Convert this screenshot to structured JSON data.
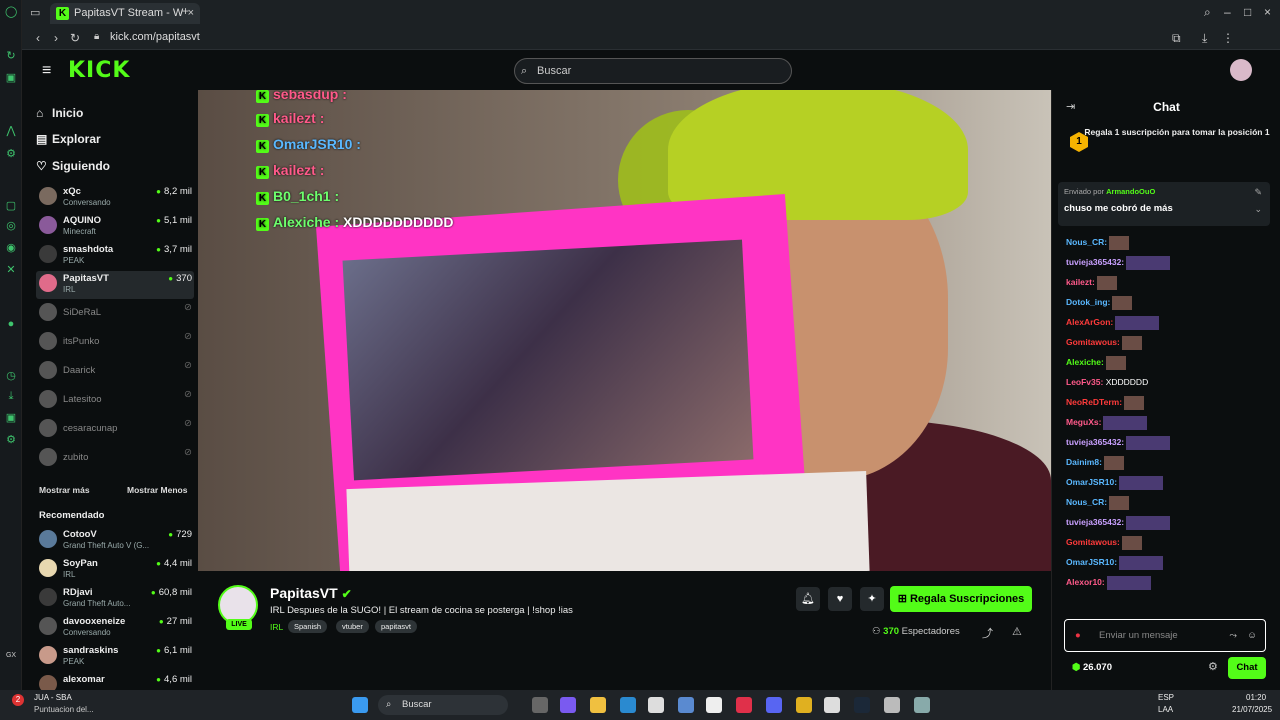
{
  "browser": {
    "tab_title": "PapitasVT Stream - W",
    "url": "kick.com/papitasvt"
  },
  "header": {
    "logo": "KICK",
    "search_placeholder": "Buscar"
  },
  "nav": {
    "home": "Inicio",
    "explore": "Explorar",
    "following": "Siguiendo"
  },
  "following": [
    {
      "name": "xQc",
      "category": "Conversando",
      "viewers": "8,2 mil",
      "live": true
    },
    {
      "name": "AQUINO",
      "category": "Minecraft",
      "viewers": "5,1 mil",
      "live": true
    },
    {
      "name": "smashdota",
      "category": "PEAK",
      "viewers": "3,7 mil",
      "live": true
    },
    {
      "name": "PapitasVT",
      "category": "IRL",
      "viewers": "370",
      "live": true
    },
    {
      "name": "SiDeRaL",
      "category": "",
      "viewers": "",
      "live": false
    },
    {
      "name": "itsPunko",
      "category": "",
      "viewers": "",
      "live": false
    },
    {
      "name": "Daarick",
      "category": "",
      "viewers": "",
      "live": false
    },
    {
      "name": "Latesitoo",
      "category": "",
      "viewers": "",
      "live": false
    },
    {
      "name": "cesaracunap",
      "category": "",
      "viewers": "",
      "live": false
    },
    {
      "name": "zubito",
      "category": "",
      "viewers": "",
      "live": false
    }
  ],
  "show_more": "Mostrar más",
  "show_less": "Mostrar Menos",
  "recommended_label": "Recomendado",
  "recommended": [
    {
      "name": "CotooV",
      "category": "Grand Theft Auto V (G...",
      "viewers": "729"
    },
    {
      "name": "SoyPan",
      "category": "IRL",
      "viewers": "4,4 mil"
    },
    {
      "name": "RDjavi",
      "category": "Grand Theft Auto...",
      "viewers": "60,8 mil"
    },
    {
      "name": "davooxeneize",
      "category": "Conversando",
      "viewers": "27 mil"
    },
    {
      "name": "sandraskins",
      "category": "PEAK",
      "viewers": "6,1 mil"
    },
    {
      "name": "alexomar",
      "category": "",
      "viewers": "4,6 mil"
    }
  ],
  "overlay_chat": [
    {
      "user": "sebasdup :",
      "msg": "",
      "color": "red"
    },
    {
      "user": "kailezt :",
      "msg": "",
      "color": "red"
    },
    {
      "user": "OmarJSR10 :",
      "msg": "",
      "color": "blue"
    },
    {
      "user": "kailezt :",
      "msg": "",
      "color": "red"
    },
    {
      "user": "B0_1ch1 :",
      "msg": "",
      "color": "green"
    },
    {
      "user": "Alexiche :",
      "msg": "XDDDDDDDDDD",
      "color": "green"
    }
  ],
  "stream": {
    "streamer": "PapitasVT",
    "title": "IRL Despues de la SUGO!  | El stream de cocina se posterga | !shop !ias",
    "category": "IRL",
    "tags": [
      "Spanish",
      "vtuber",
      "papitasvt"
    ],
    "live_badge": "LIVE",
    "subscribe_label": "Regala Suscripciones",
    "viewers_count": "370",
    "viewers_label": "Espectadores"
  },
  "chat": {
    "title": "Chat",
    "gift_rank": "1",
    "gift_prompt": "Regala 1 suscripción para tomar la posición 1",
    "pinned_by_label": "Enviado por",
    "pinned_by_user": "ArmandoOuO",
    "pinned_text": "chuso me cobró de más",
    "messages": [
      {
        "user": "Nous_CR:",
        "color": "#5ab8ff",
        "text": "",
        "emote": "brown"
      },
      {
        "user": "tuvieja365432:",
        "color": "#c9a0ff",
        "text": "",
        "emote": "purple"
      },
      {
        "user": "kailezt:",
        "color": "#ff5a8a",
        "text": "",
        "emote": "brown"
      },
      {
        "user": "Dotok_ing:",
        "color": "#5ab8ff",
        "text": "",
        "emote": "brown"
      },
      {
        "user": "AlexArGon:",
        "color": "#ff3b3b",
        "text": "",
        "emote": "purple"
      },
      {
        "user": "Gomitawous:",
        "color": "#ff3b3b",
        "text": "",
        "emote": "brown"
      },
      {
        "user": "Alexiche:",
        "color": "#53fc18",
        "text": "",
        "emote": "brown"
      },
      {
        "user": "LeoFv35:",
        "color": "#ff5a8a",
        "text": "XDDDDDD",
        "emote": ""
      },
      {
        "user": "NeoReDTerm:",
        "color": "#ff3b3b",
        "text": "",
        "emote": "brown"
      },
      {
        "user": "MeguXs:",
        "color": "#ff5a8a",
        "text": "",
        "emote": "purple"
      },
      {
        "user": "tuvieja365432:",
        "color": "#c9a0ff",
        "text": "",
        "emote": "purple"
      },
      {
        "user": "Dainim8:",
        "color": "#5ab8ff",
        "text": "",
        "emote": "brown"
      },
      {
        "user": "OmarJSR10:",
        "color": "#5ab8ff",
        "text": "",
        "emote": "purple"
      },
      {
        "user": "Nous_CR:",
        "color": "#5ab8ff",
        "text": "",
        "emote": "brown"
      },
      {
        "user": "tuvieja365432:",
        "color": "#c9a0ff",
        "text": "",
        "emote": "purple"
      },
      {
        "user": "Gomitawous:",
        "color": "#ff3b3b",
        "text": "",
        "emote": "brown"
      },
      {
        "user": "OmarJSR10:",
        "color": "#5ab8ff",
        "text": "",
        "emote": "purple"
      },
      {
        "user": "Alexor10:",
        "color": "#ff5a8a",
        "text": "",
        "emote": "purple"
      }
    ],
    "input_placeholder": "Enviar un mensaje",
    "points": "26.070",
    "send_label": "Chat"
  },
  "taskbar": {
    "notif_count": "2",
    "notif_app": "JUA - SBA",
    "notif_sub": "Puntuacion del...",
    "search_label": "Buscar",
    "lang": "ESP",
    "lang_sub": "LAA",
    "time": "01:20",
    "date": "21/07/2025"
  },
  "colors": {
    "accent": "#53fc18",
    "bg": "#0b0e0f",
    "video_overlay_pink": "#ff34c4"
  }
}
